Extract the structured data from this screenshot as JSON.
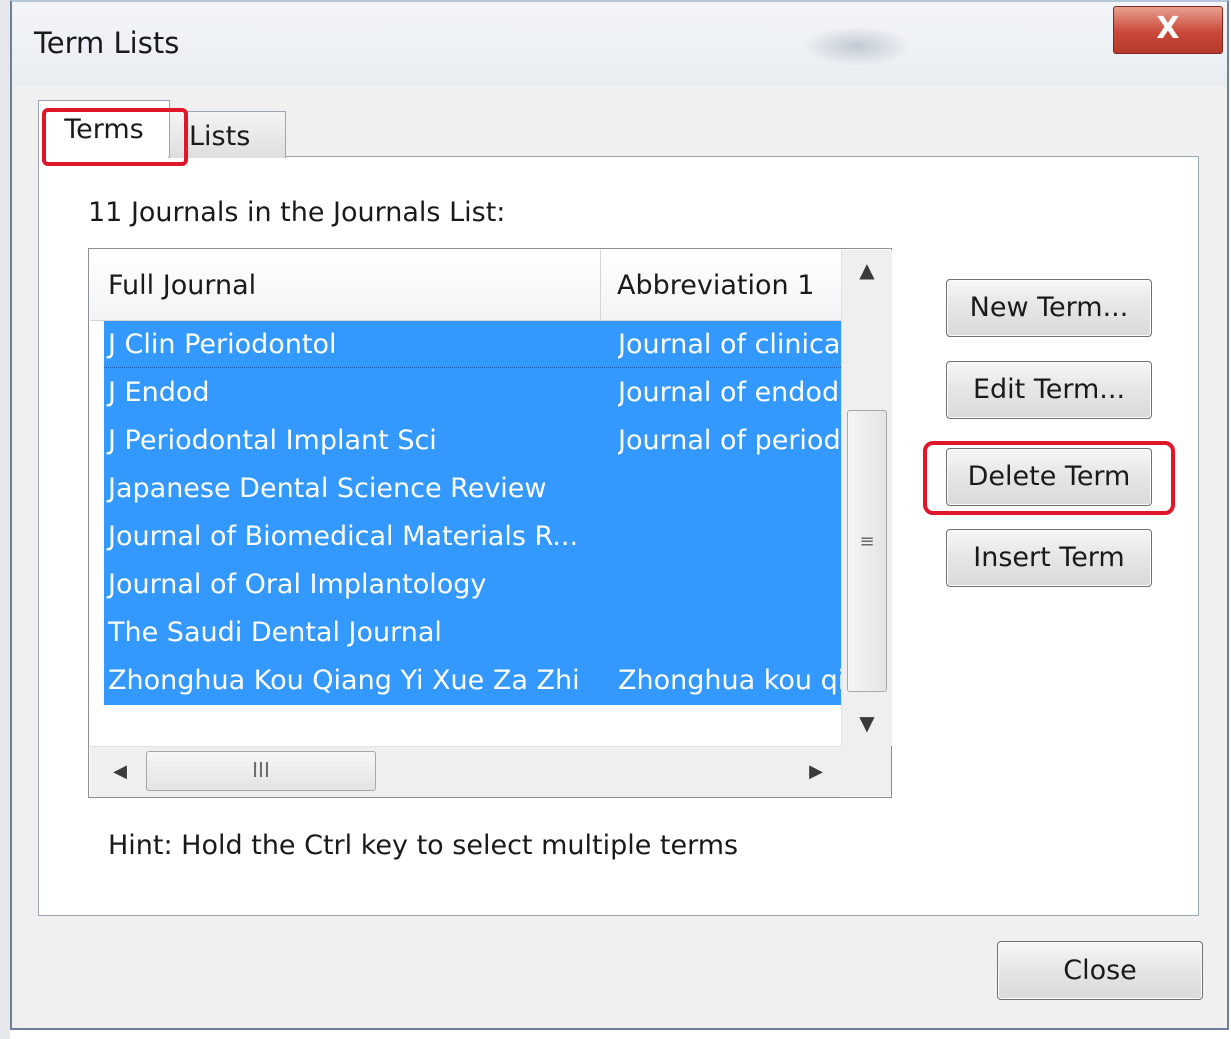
{
  "window": {
    "title": "Term Lists",
    "close_glyph": "X",
    "accent_highlight": "#e0162b",
    "selection_color": "#3399ff"
  },
  "tabs": [
    {
      "label": "Terms",
      "selected": true
    },
    {
      "label": "Lists",
      "selected": false
    }
  ],
  "list": {
    "count_label": "11 Journals in the Journals List:",
    "columns": [
      "Full Journal",
      "Abbreviation 1"
    ],
    "rows": [
      {
        "full": "J Clin Periodontol",
        "abbr": "Journal of clinica"
      },
      {
        "full": "J Endod",
        "abbr": "Journal of endod"
      },
      {
        "full": "J Periodontal Implant Sci",
        "abbr": "Journal of periodo"
      },
      {
        "full": "Japanese Dental Science Review",
        "abbr": ""
      },
      {
        "full": "Journal of Biomedical Materials R...",
        "abbr": ""
      },
      {
        "full": "Journal of Oral Implantology",
        "abbr": ""
      },
      {
        "full": "The Saudi Dental Journal",
        "abbr": ""
      },
      {
        "full": "Zhonghua Kou Qiang Yi Xue Za Zhi",
        "abbr": "Zhonghua kou qi"
      }
    ],
    "scroll": {
      "up_icon": "▲",
      "down_icon": "▼",
      "left_icon": "◀",
      "right_icon": "▶",
      "v_grip": "≡",
      "h_grip": "III"
    }
  },
  "buttons": {
    "new_term": "New Term...",
    "edit_term": "Edit Term...",
    "delete_term": "Delete Term",
    "insert_term": "Insert Term",
    "close": "Close"
  },
  "hint": "Hint: Hold the Ctrl key to select multiple terms"
}
